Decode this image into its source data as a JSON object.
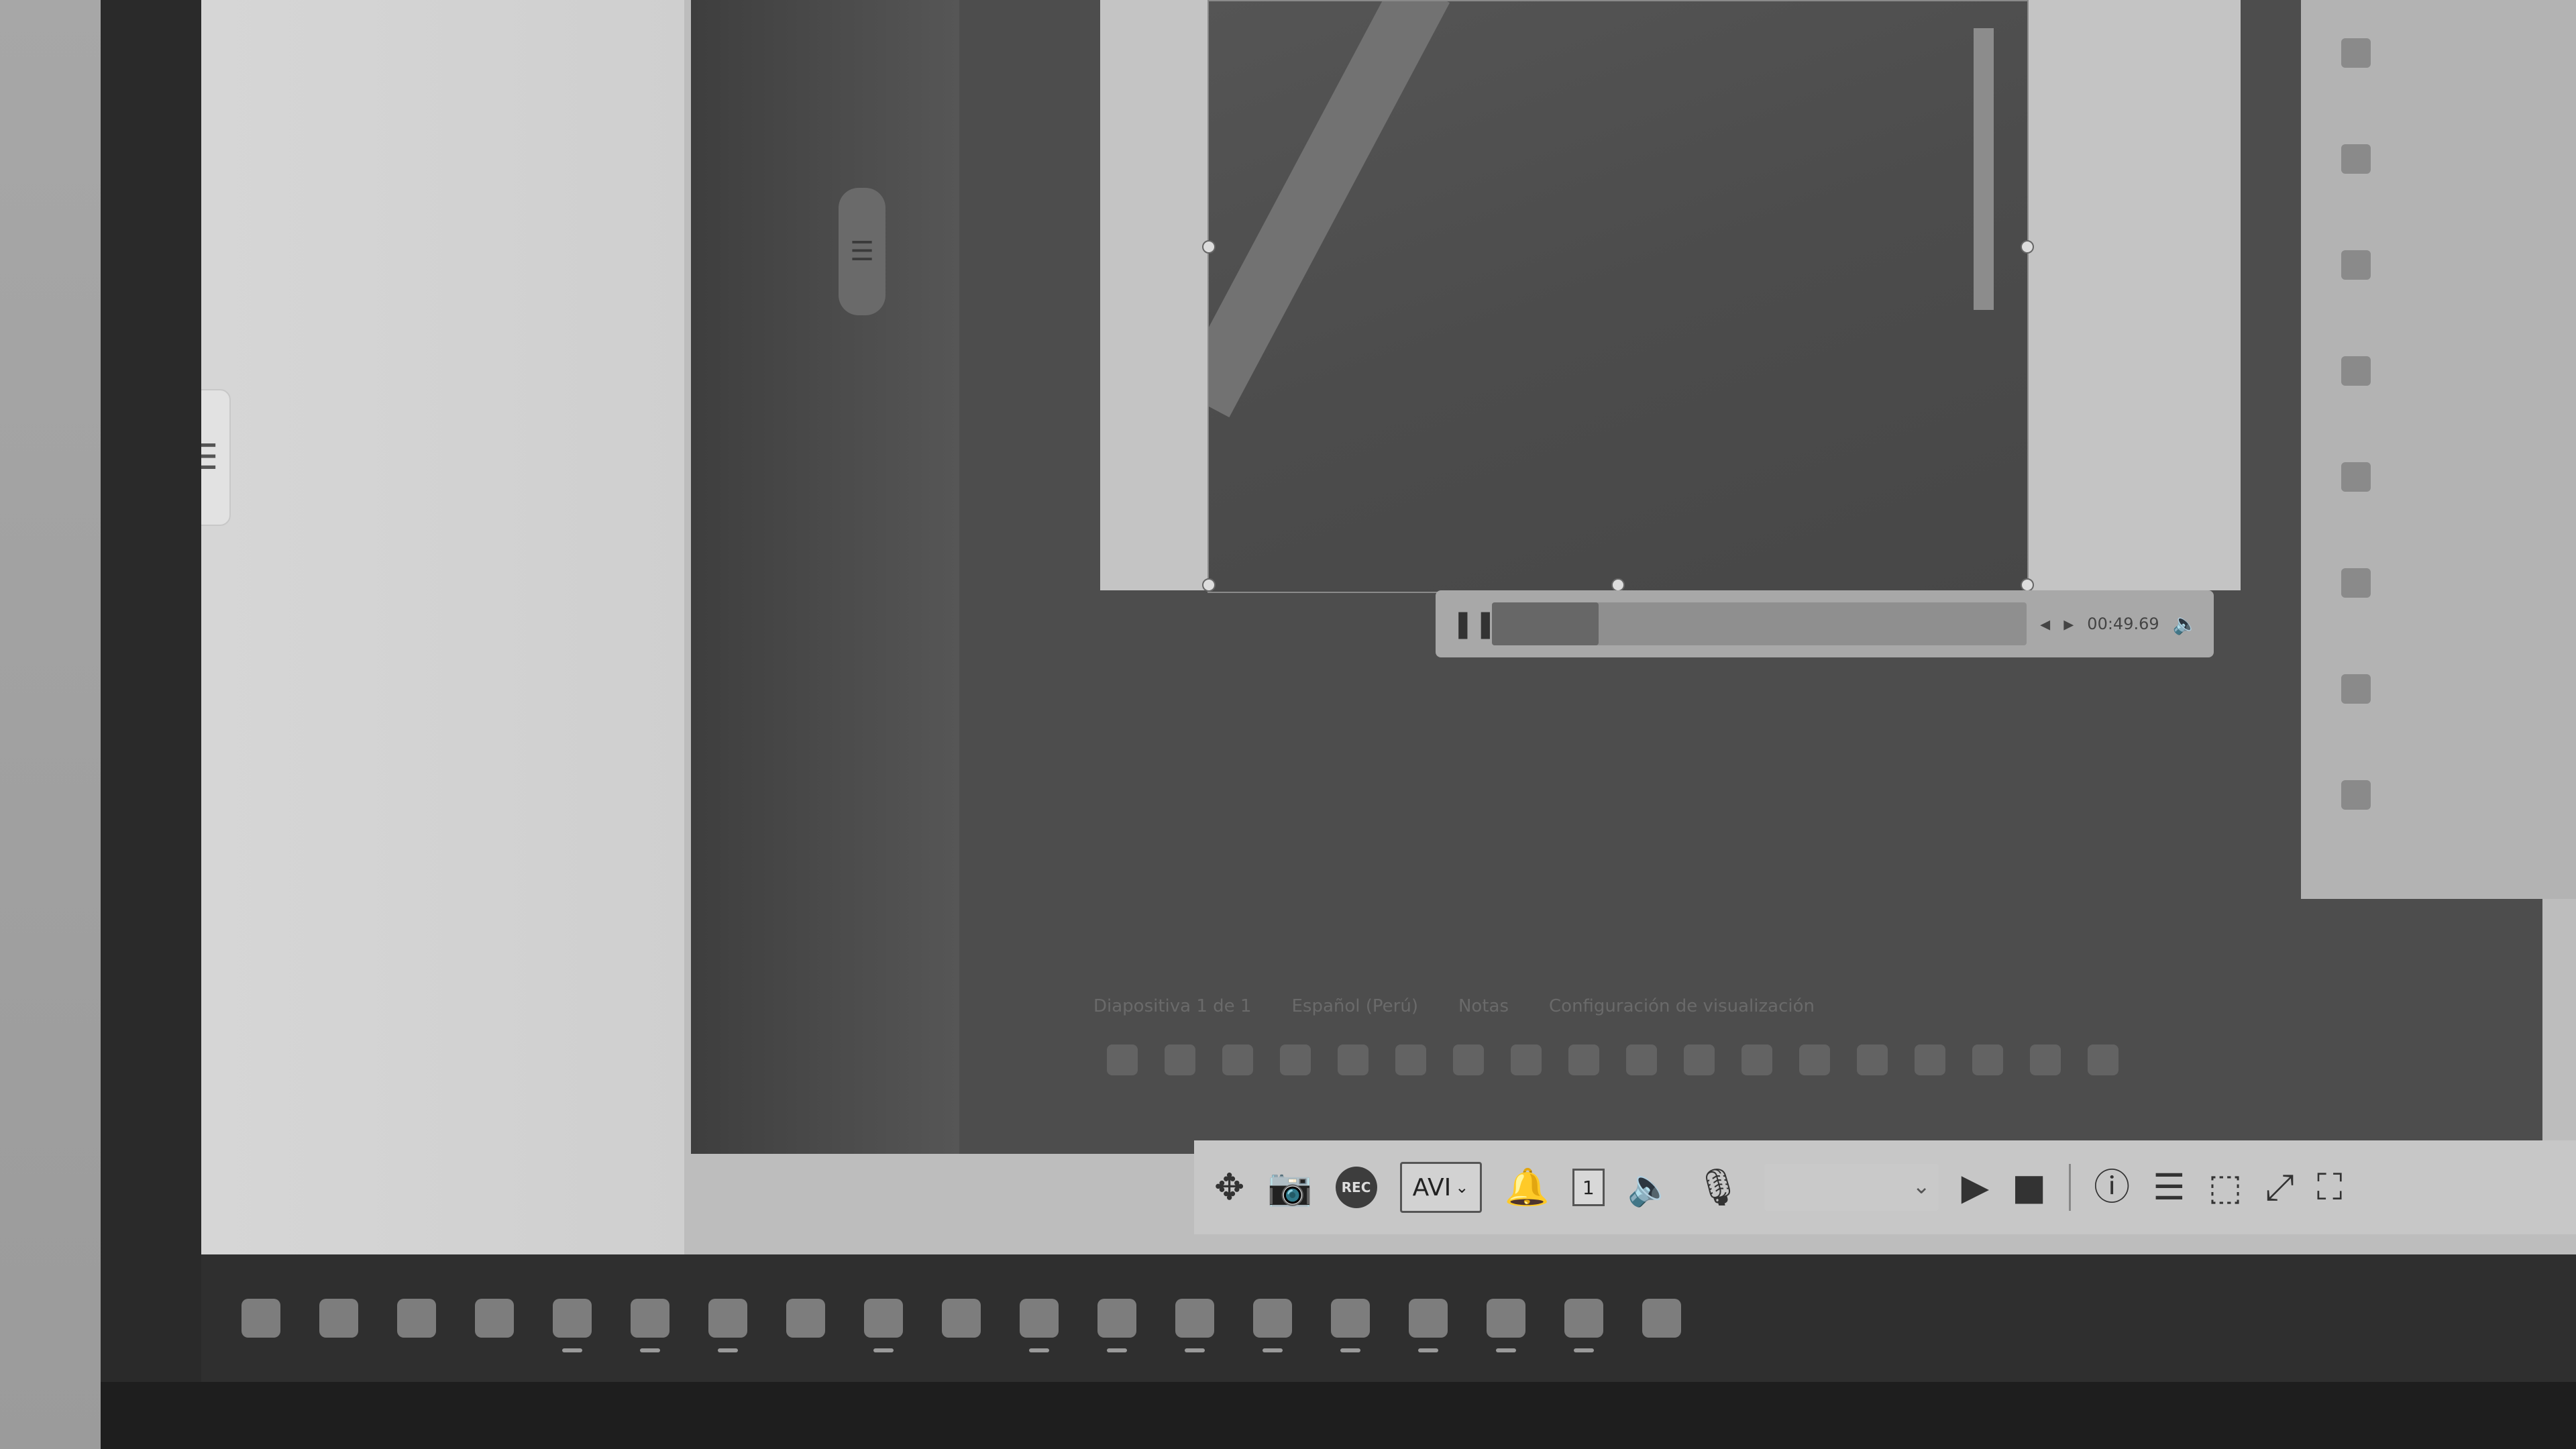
{
  "remote_screen": {
    "status": {
      "slide_label": "Diapositiva 1 de 1",
      "language_label": "Español (Perú)",
      "notes_label": "Notas",
      "display_settings_label": "Configuración de visualización"
    }
  },
  "media_player": {
    "time": "00:49.69",
    "progress_fraction": 0.2
  },
  "viewer_toolbar": {
    "rec_label": "REC",
    "format_value": "AVI",
    "alert_count": "1"
  },
  "left_pane_tab_icon": "hamburger-menu-icon",
  "taskbar": {
    "icons": [
      "windows-start",
      "task-view",
      "widgets",
      "video-camera",
      "chrome",
      "file-explorer",
      "edge",
      "bing",
      "notepad",
      "visual-studio-code",
      "chromium",
      "edit-pen",
      "chrome-beta",
      "remote-desktop",
      "acrobat",
      "terminal",
      "outlook",
      "powerpoint",
      "dev-tool"
    ]
  }
}
